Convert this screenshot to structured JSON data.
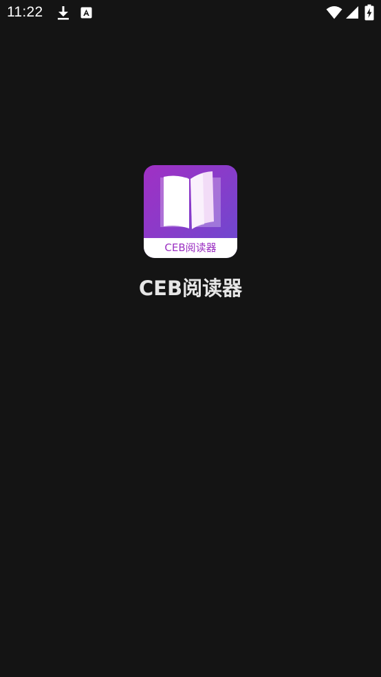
{
  "status_bar": {
    "time": "11:22",
    "left_icons": [
      "download-icon",
      "font-icon"
    ],
    "right_icons": [
      "wifi-icon",
      "signal-icon",
      "battery-charging-icon"
    ]
  },
  "splash": {
    "logo_icon": "open-book-icon",
    "logo_label": "CEB阅读器",
    "app_name": "CEB阅读器"
  },
  "colors": {
    "background": "#141414",
    "logo_gradient_start": "#a030c4",
    "logo_gradient_end": "#6a4ad0",
    "logo_label_text": "#9b2fc2",
    "app_name_text": "#e6e6e6"
  }
}
